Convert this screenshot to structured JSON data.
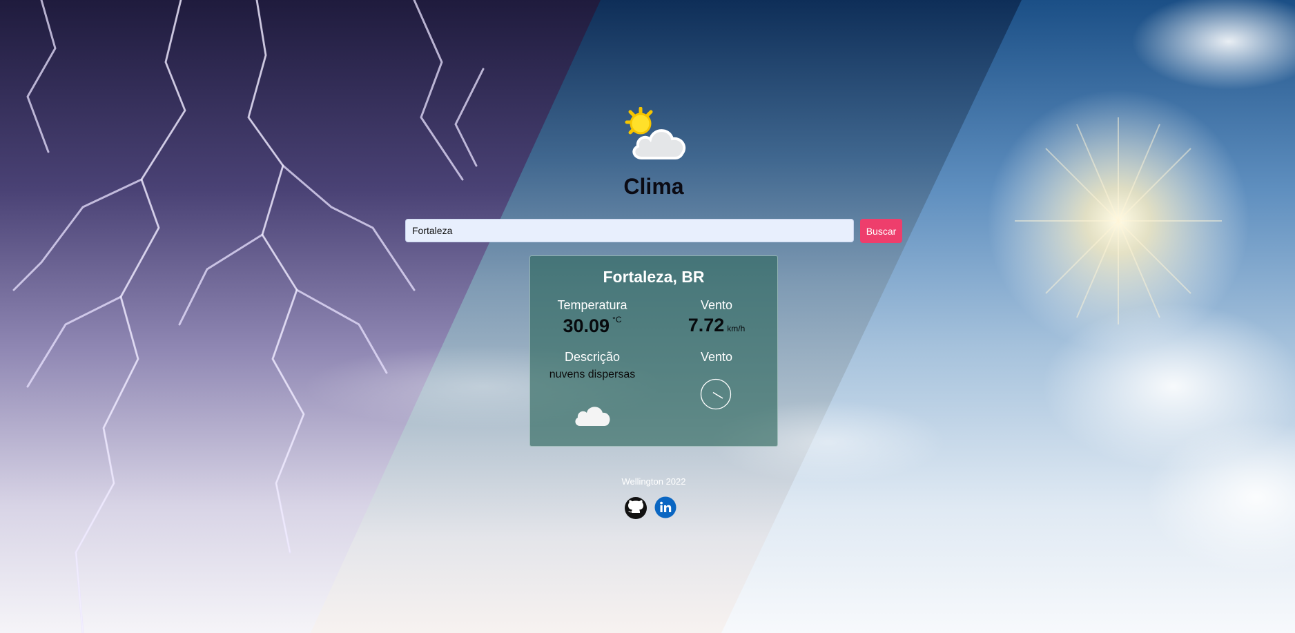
{
  "app": {
    "title": "Clima",
    "logo_icon": "partly-cloudy-icon"
  },
  "search": {
    "value": "Fortaleza",
    "placeholder": "",
    "button_label": "Buscar",
    "button_color": "#ee3e6c"
  },
  "weather": {
    "city": "Fortaleza, BR",
    "temperature_label": "Temperatura",
    "temperature_value": "30.09",
    "temperature_unit": "°C",
    "wind_label": "Vento",
    "wind_value": "7.72",
    "wind_unit": "km/h",
    "description_label": "Descrição",
    "description_value": "nuvens dispersas",
    "description_icon": "cloud-icon",
    "wind_direction_label": "Vento",
    "wind_direction_icon": "wind-direction-icon"
  },
  "footer": {
    "credit": "Wellington 2022",
    "links": [
      {
        "name": "github",
        "icon": "github-icon"
      },
      {
        "name": "linkedin",
        "icon": "linkedin-icon",
        "color": "#0a66c2"
      }
    ]
  }
}
